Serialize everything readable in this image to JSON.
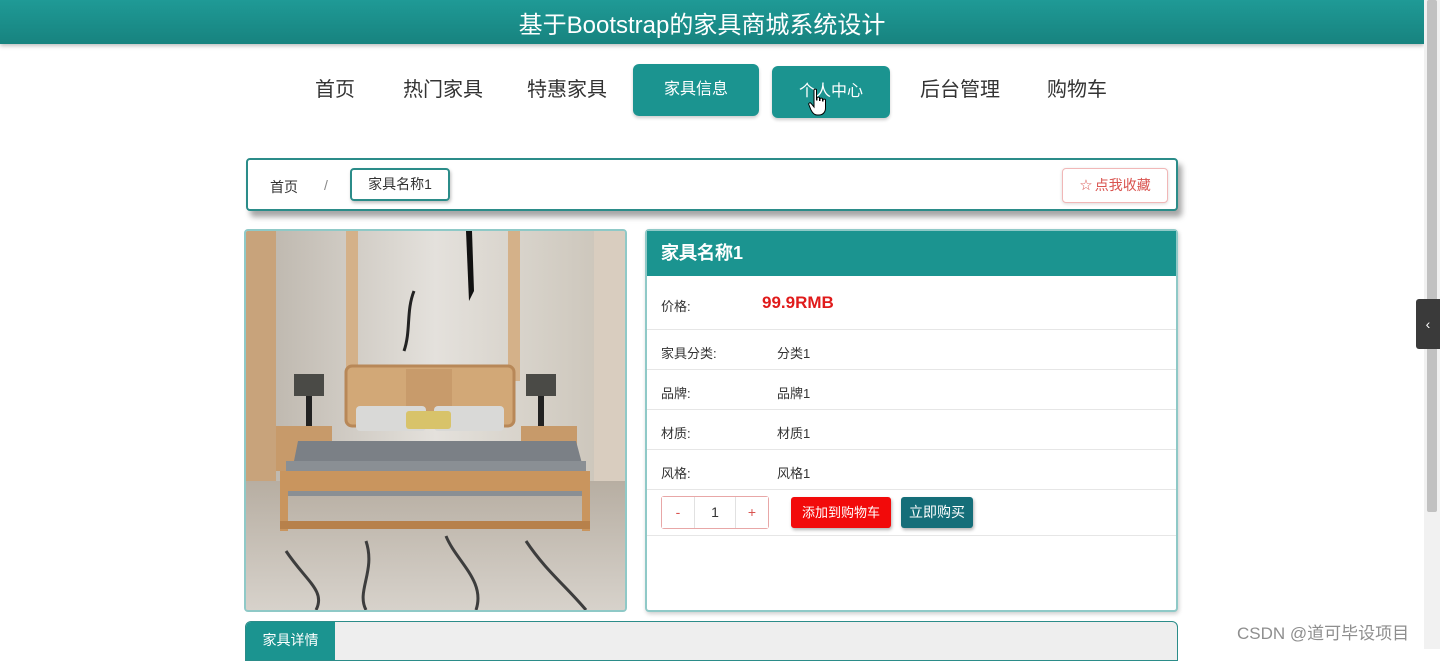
{
  "header": {
    "title": "基于Bootstrap的家具商城系统设计"
  },
  "nav": {
    "items": [
      {
        "label": "首页"
      },
      {
        "label": "热门家具"
      },
      {
        "label": "特惠家具"
      },
      {
        "label": "家具信息"
      },
      {
        "label": "个人中心"
      },
      {
        "label": "后台管理"
      },
      {
        "label": "购物车"
      }
    ],
    "active_color": "#1b9490"
  },
  "breadcrumb": {
    "home": "首页",
    "separator": "/",
    "current": "家具名称1",
    "favorite_label": "点我收藏",
    "favorite_icon": "star-outline-icon"
  },
  "product": {
    "name": "家具名称1",
    "price_label": "价格:",
    "price": "99.9RMB",
    "price_color": "#e01b1b",
    "attributes": [
      {
        "label": "家具分类:",
        "value": "分类1"
      },
      {
        "label": "品牌:",
        "value": "品牌1"
      },
      {
        "label": "材质:",
        "value": "材质1"
      },
      {
        "label": "风格:",
        "value": "风格1"
      }
    ],
    "quantity": {
      "minus": "-",
      "value": "1",
      "plus": "+"
    },
    "add_to_cart": "添加到购物车",
    "buy_now": "立即购买"
  },
  "detail_tab": {
    "label": "家具详情"
  },
  "side_toggle": {
    "icon": "chevron-left-icon",
    "glyph": "‹"
  },
  "watermark": "CSDN @道可毕设项目"
}
